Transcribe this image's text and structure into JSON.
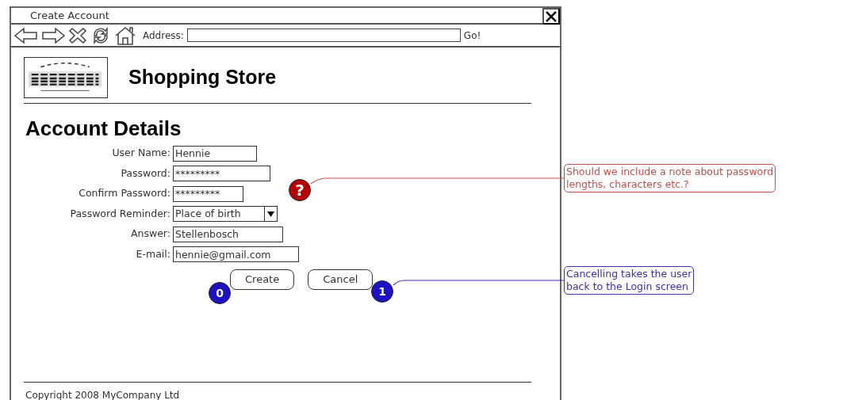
{
  "window": {
    "title": "Create Account"
  },
  "toolbar": {
    "address_label": "Address:",
    "go": "Go!"
  },
  "site": {
    "name": "Shopping Store"
  },
  "heading": "Account Details",
  "form": {
    "fields": [
      {
        "label": "User Name:",
        "value": "Hennie",
        "kind": "text"
      },
      {
        "label": "Password:",
        "value": "*********",
        "kind": "text"
      },
      {
        "label": "Confirm Password:",
        "value": "*********",
        "kind": "text"
      },
      {
        "label": "Password Reminder:",
        "value": "Place of birth",
        "kind": "select"
      },
      {
        "label": "Answer:",
        "value": "Stellenbosch",
        "kind": "text"
      },
      {
        "label": "E-mail:",
        "value": "hennie@gmail.com",
        "kind": "text"
      }
    ],
    "buttons": [
      "Create",
      "Cancel"
    ]
  },
  "footer": "Copyright 2008 MyCompany Ltd",
  "markers": [
    {
      "label": "?",
      "color": "#b00000"
    },
    {
      "label": "0",
      "color": "#1c12c0"
    },
    {
      "label": "1",
      "color": "#1c12c0"
    }
  ],
  "notes": [
    {
      "lines": [
        "Should we include a note about password",
        "lengths, characters etc.?"
      ],
      "color": "#c0504d"
    },
    {
      "lines": [
        "Cancelling takes the user",
        "back to the Login screen"
      ],
      "color": "#3a32b0"
    }
  ]
}
